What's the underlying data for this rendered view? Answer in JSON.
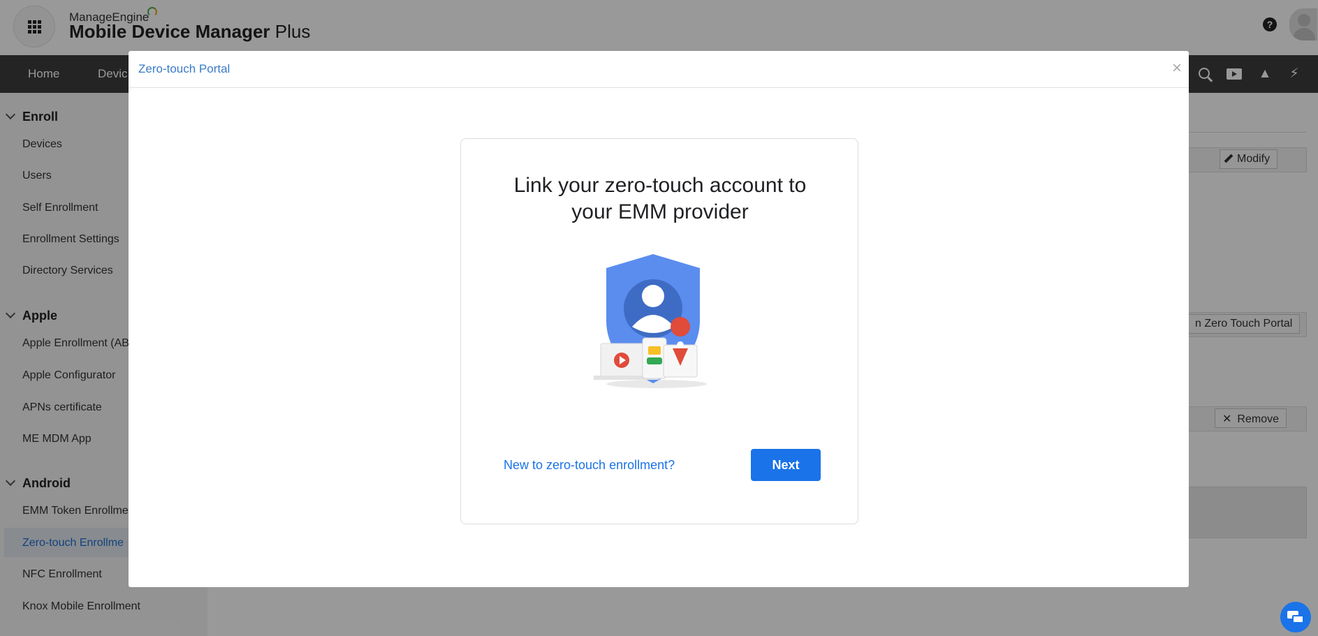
{
  "header": {
    "brand_top": "ManageEngine",
    "brand_name_bold": "Mobile Device Manager",
    "brand_name_rest": " Plus",
    "help_glyph": "?"
  },
  "nav": {
    "items": [
      "Home",
      "Devic"
    ]
  },
  "sidebar": {
    "groups": [
      {
        "label": "Enroll",
        "items": [
          "Devices",
          "Users",
          "Self Enrollment",
          "Enrollment Settings",
          "Directory Services"
        ]
      },
      {
        "label": "Apple",
        "items": [
          "Apple Enrollment (AB",
          "Apple Configurator",
          "APNs certificate",
          "ME MDM App"
        ]
      },
      {
        "label": "Android",
        "items": [
          "EMM Token Enrollme",
          "Zero-touch Enrollme",
          "NFC Enrollment",
          "Knox Mobile Enrollment"
        ]
      }
    ],
    "active_item": "Zero-touch Enrollme"
  },
  "main": {
    "modify_label": "Modify",
    "zero_touch_portal_label": "n Zero Touch Portal",
    "remove_label": "Remove"
  },
  "modal": {
    "title": "Zero-touch Portal",
    "close_glyph": "×",
    "heading_line1": "Link your zero-touch account to",
    "heading_line2": "your EMM provider",
    "new_link": "New to zero-touch enrollment?",
    "next_label": "Next"
  },
  "colors": {
    "accent": "#1a73e8",
    "nav_bg": "#3d3d3d",
    "shield": "#5b8def"
  },
  "icons": [
    "apps-grid-icon",
    "help-icon",
    "search-icon",
    "video-icon",
    "rocket-icon",
    "flash-icon",
    "pencil-icon",
    "close-icon",
    "chat-icon"
  ]
}
